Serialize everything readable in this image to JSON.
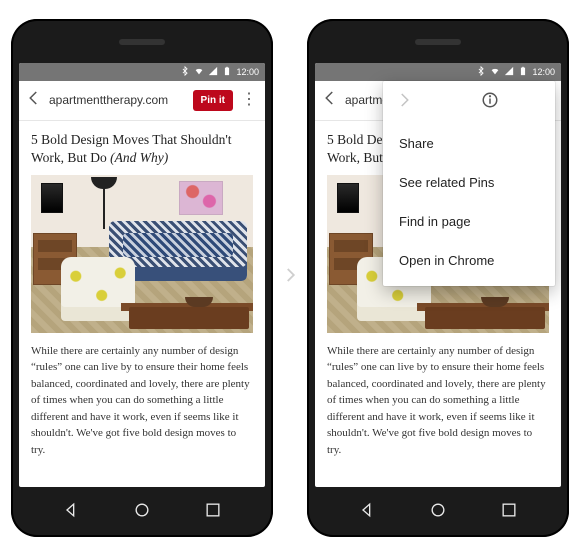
{
  "status": {
    "time": "12:00"
  },
  "appbar": {
    "url": "apartmenttherapy.com",
    "pin_label": "Pin it"
  },
  "article": {
    "title_a": "5 Bold Design Moves That Shouldn't Work, But Do ",
    "title_b": "(And Why)",
    "paragraph": "While there are certainly any number of design “rules” one can live by to ensure their home feels balanced, coordinated and lovely, there are plenty of times when you can do something a little different and have it work, even if seems like it shouldn't. We've got five bold design moves to try."
  },
  "menu": {
    "items": [
      "Share",
      "See related Pins",
      "Find in page",
      "Open in Chrome"
    ]
  }
}
